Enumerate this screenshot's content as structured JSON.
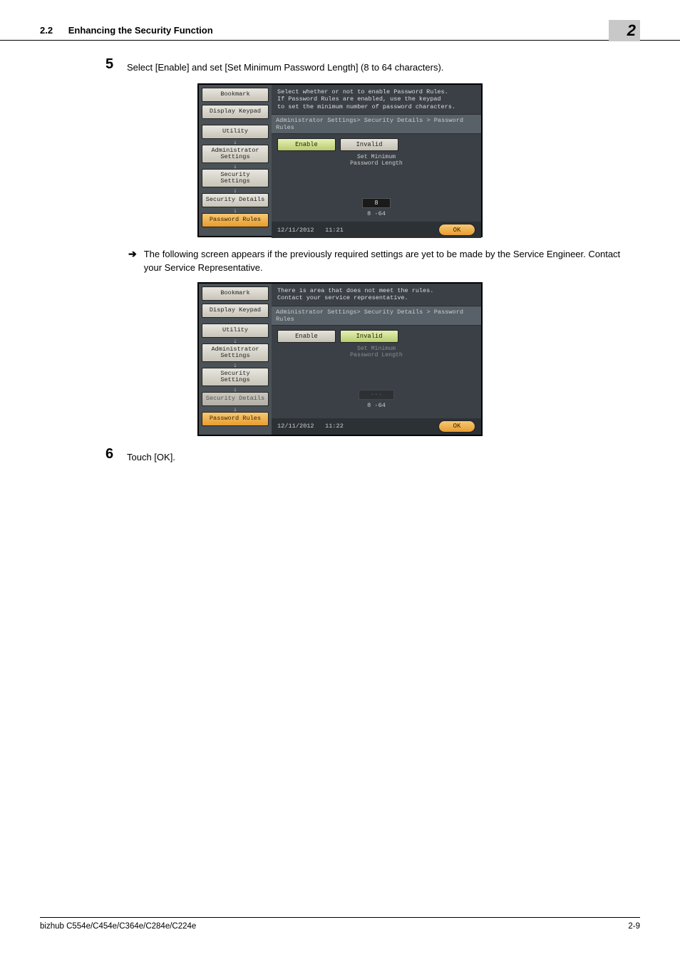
{
  "header": {
    "section_no": "2.2",
    "section_title": "Enhancing the Security Function",
    "chapter_badge": "2"
  },
  "step5": {
    "num": "5",
    "text": "Select [Enable] and set [Set Minimum Password Length] (8 to 64 characters)."
  },
  "panel1": {
    "left": {
      "bookmark": "Bookmark",
      "display_keypad": "Display Keypad",
      "utility": "Utility",
      "admin_settings": "Administrator\nSettings",
      "security_settings": "Security\nSettings",
      "security_details": "Security Details",
      "password_rules": "Password Rules"
    },
    "top_msg": "Select whether or not to enable Password Rules.\nIf Password Rules are enabled, use the keypad\nto set the minimum number of password characters.",
    "crumb": "Administrator Settings> Security Details > Password Rules",
    "tab_enable": "Enable",
    "tab_invalid": "Invalid",
    "field_label": "Set Minimum\nPassword Length",
    "value": "8",
    "range": "8 -64",
    "date": "12/11/2012",
    "time": "11:21",
    "ok": "OK"
  },
  "bullet1": {
    "text": "The following screen appears if the previously required settings are yet to be made by the Service Engineer. Contact your Service Representative."
  },
  "panel2": {
    "top_msg": "There is area that does not meet the rules.\nContact your service representative.",
    "crumb": "Administrator Settings> Security Details > Password Rules",
    "tab_enable": "Enable",
    "tab_invalid": "Invalid",
    "field_label": "Set Minimum\nPassword Length",
    "value": "---",
    "range": "8 -64",
    "date": "12/11/2012",
    "time": "11:22",
    "ok": "OK"
  },
  "step6": {
    "num": "6",
    "text": "Touch [OK]."
  },
  "footer": {
    "model": "bizhub C554e/C454e/C364e/C284e/C224e",
    "page": "2-9"
  }
}
